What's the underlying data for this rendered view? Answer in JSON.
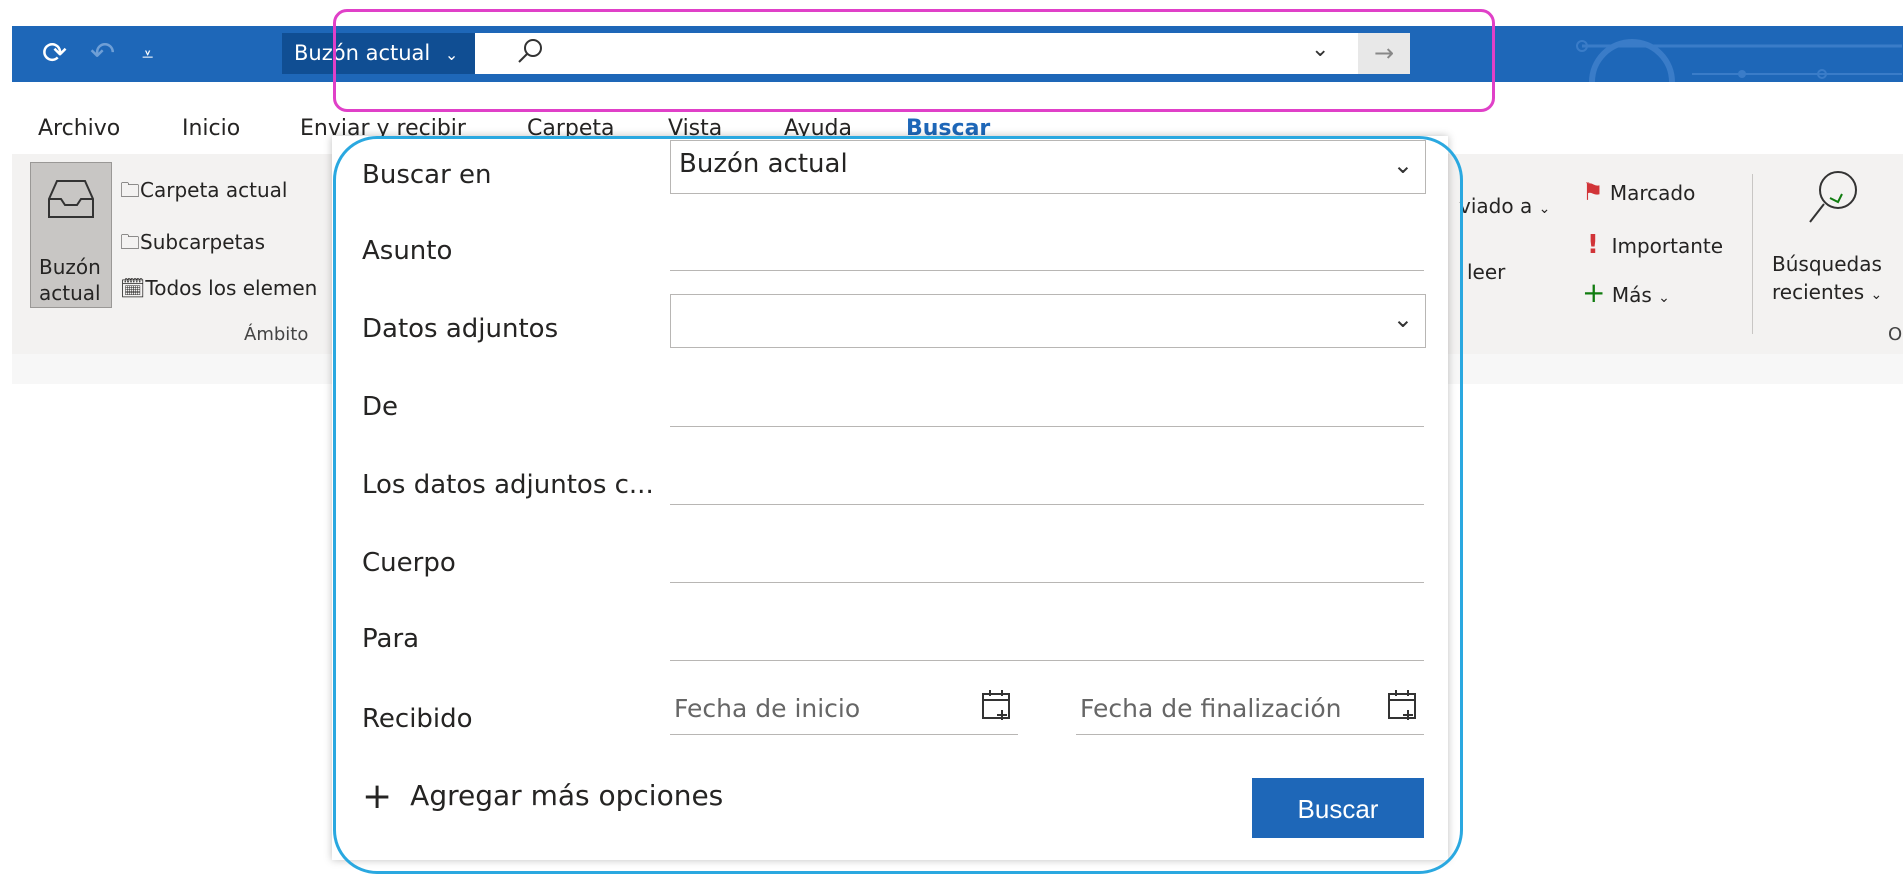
{
  "colors": {
    "titlebar": "#1e67b8",
    "accent": "#1e67b8",
    "highlight_search": "#e040c8",
    "highlight_dialog": "#2aa8e0",
    "flag": "#d13438"
  },
  "titlebar": {
    "icons": [
      "refresh-icon",
      "undo-icon",
      "quick-access-icon"
    ],
    "scope_label": "Buzón actual",
    "search_placeholder": ""
  },
  "ribbon": {
    "tabs": [
      "Archivo",
      "Inicio",
      "Enviar y recibir",
      "Carpeta",
      "Vista",
      "Ayuda",
      "Buscar"
    ],
    "active_tab": "Buscar",
    "scope": {
      "buzon_line1": "Buzón",
      "buzon_line2": "actual",
      "carpeta_actual": "Carpeta actual",
      "subcarpetas": "Subcarpetas",
      "todos": "Todos los elemen",
      "group_label": "Ámbito"
    },
    "refine": {
      "enviado": "viado a",
      "leer": "leer",
      "marcado": "Marcado",
      "importante": "Importante",
      "mas": "Más"
    },
    "options": {
      "busquedas_line1": "Búsquedas",
      "busquedas_line2": "recientes",
      "group_label": "Op"
    }
  },
  "dialog": {
    "fields": {
      "buscar_en": {
        "label": "Buscar en",
        "value": "Buzón actual"
      },
      "asunto": {
        "label": "Asunto",
        "value": ""
      },
      "datos_adjuntos": {
        "label": "Datos adjuntos",
        "value": ""
      },
      "de": {
        "label": "De",
        "value": ""
      },
      "contienen": {
        "label": "Los datos adjuntos c...",
        "value": ""
      },
      "cuerpo": {
        "label": "Cuerpo",
        "value": ""
      },
      "para": {
        "label": "Para",
        "value": ""
      },
      "recibido": {
        "label": "Recibido",
        "start_placeholder": "Fecha de inicio",
        "end_placeholder": "Fecha de finalización"
      }
    },
    "add_more": "Agregar más opciones",
    "search_button": "Buscar"
  }
}
